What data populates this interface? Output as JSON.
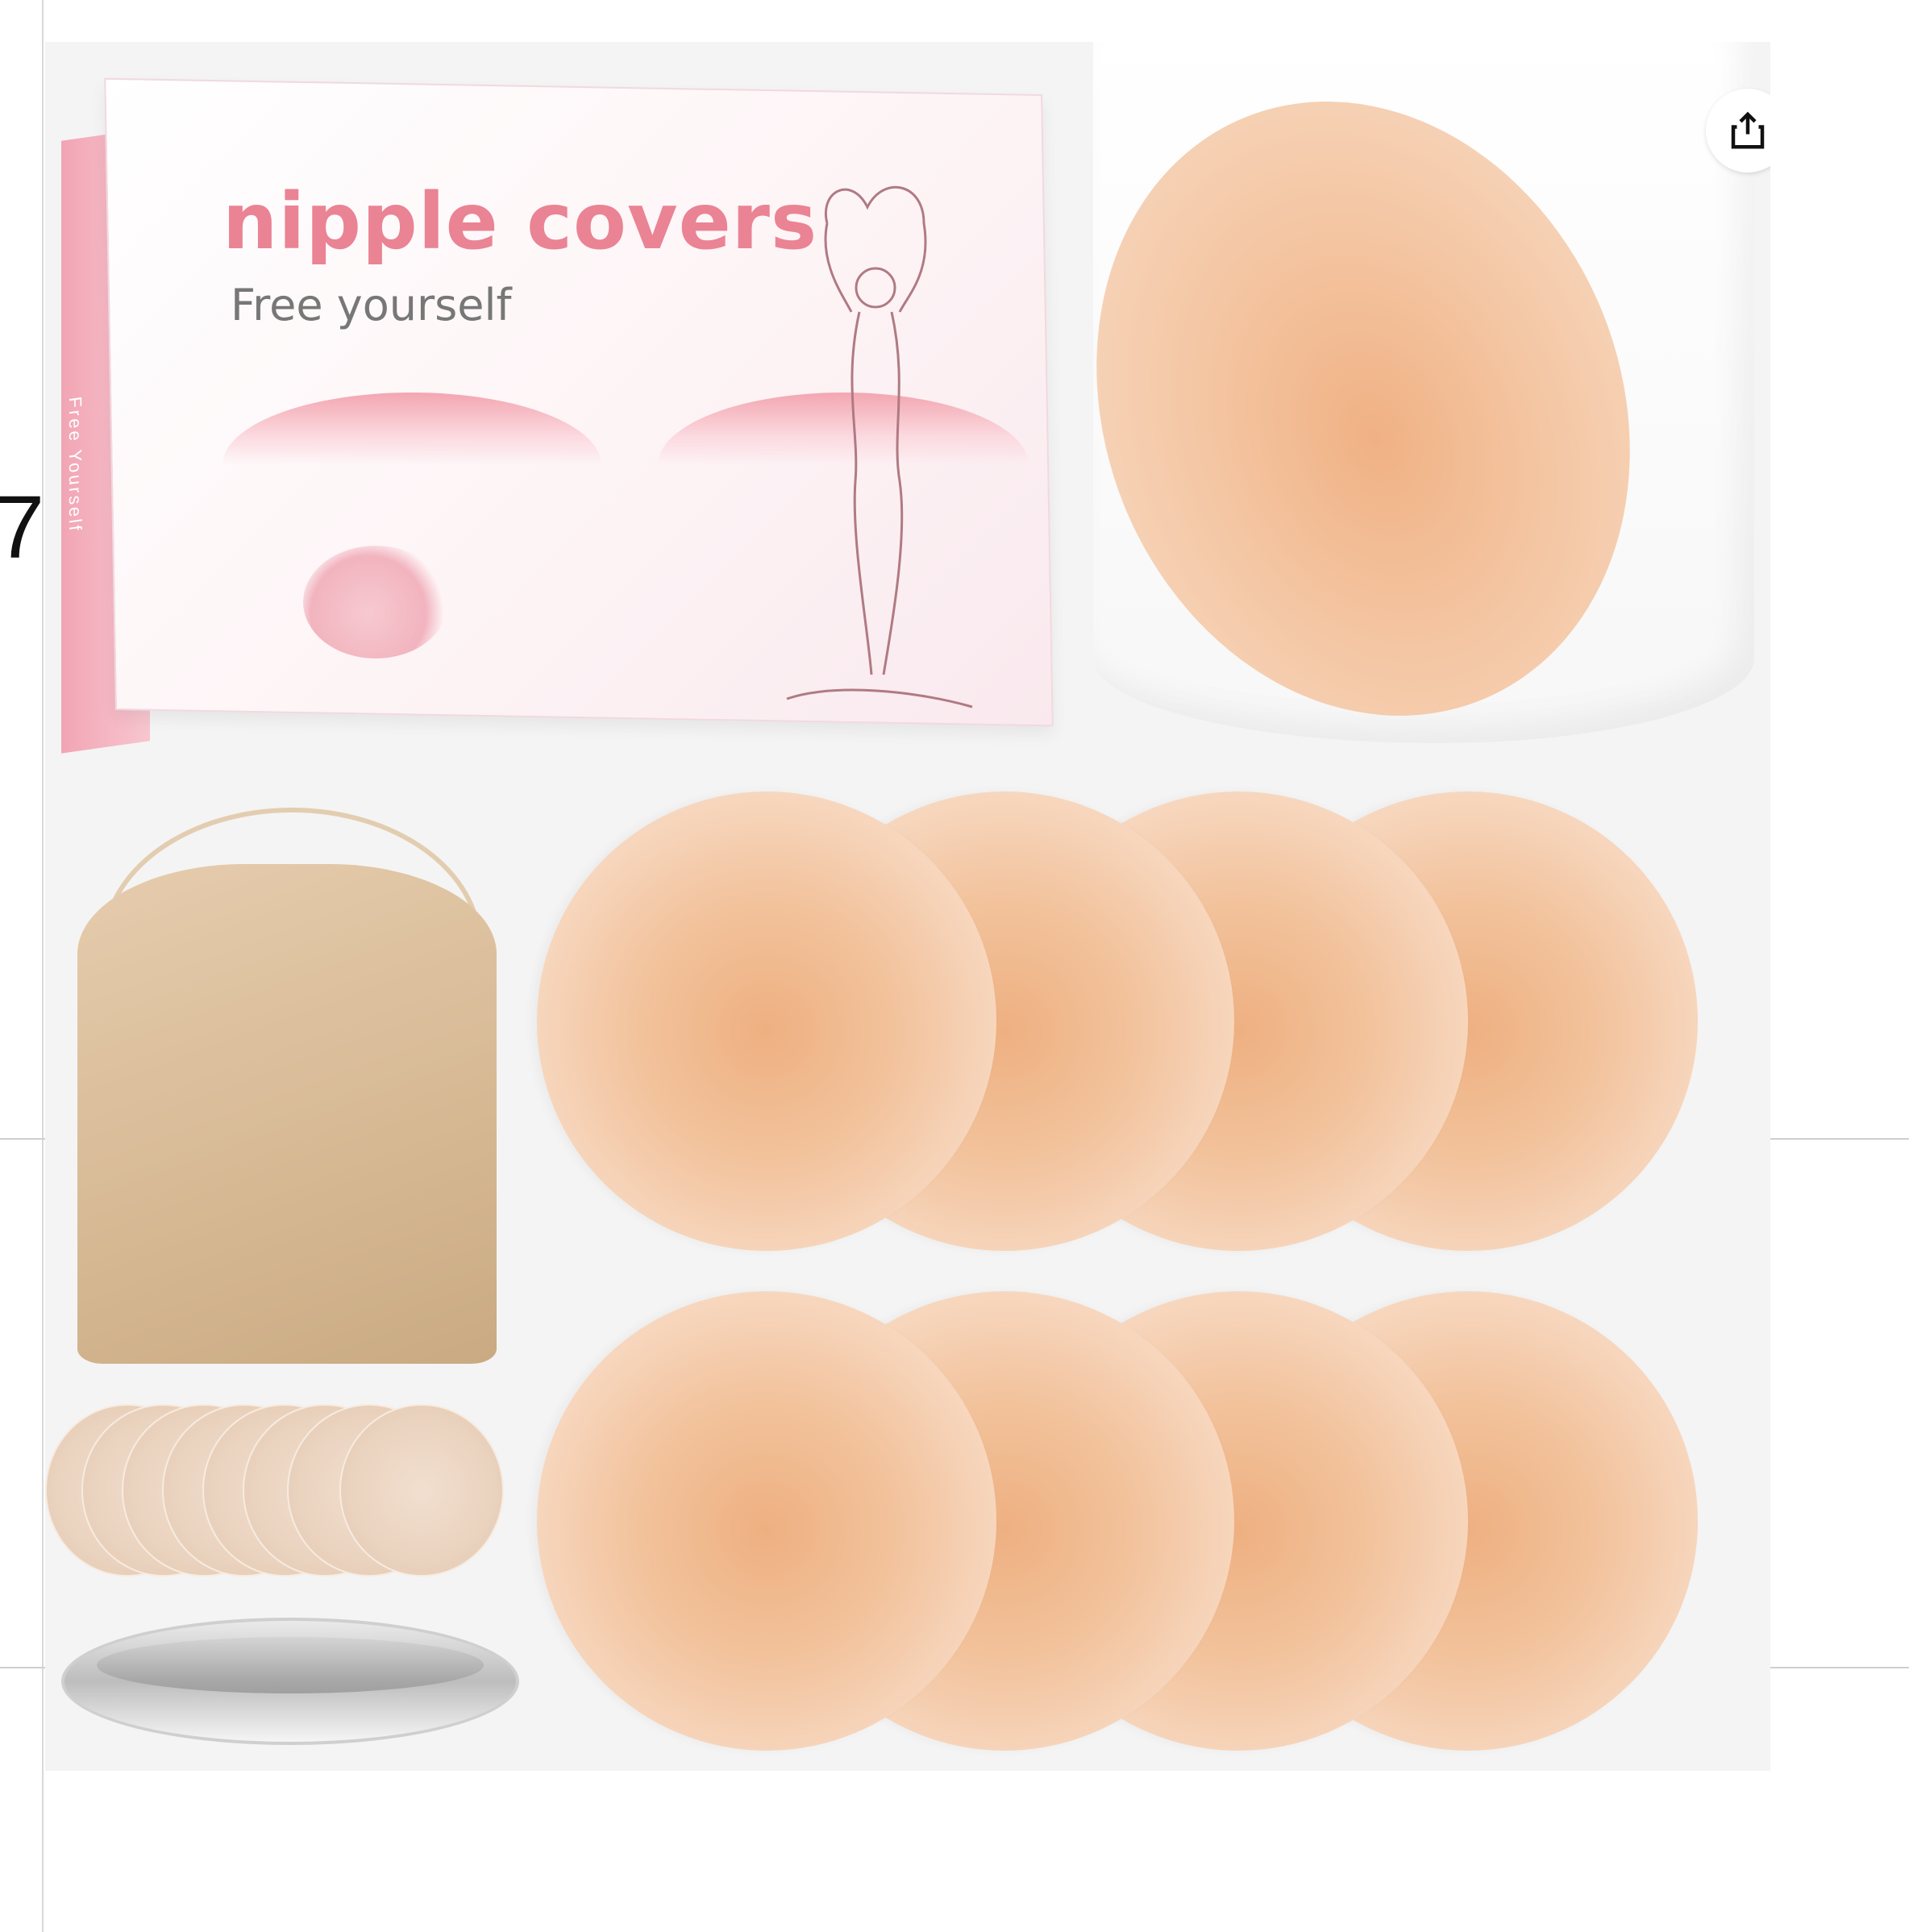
{
  "page": {
    "edge_glyph": "7"
  },
  "share": {
    "icon": "share-icon"
  },
  "box": {
    "title": "nipple covers",
    "subtitle": "Free yourself",
    "side_text": "Free Yourself",
    "colors": {
      "accent": "#ea8394",
      "side": "#f2a5b4"
    }
  },
  "product": {
    "pad_color": "#f2c29b",
    "pouch_color": "#d6b893"
  }
}
